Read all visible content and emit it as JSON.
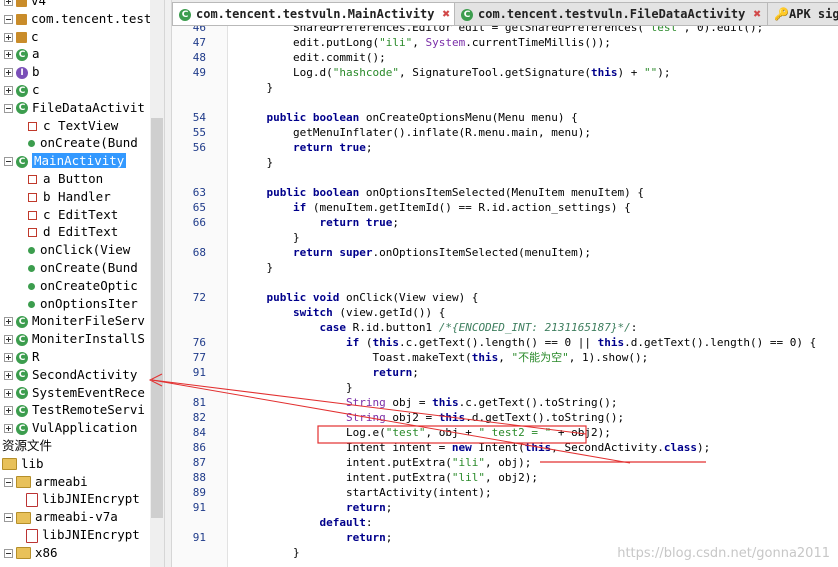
{
  "tree": {
    "items": [
      {
        "label": "v4",
        "icon": "pkg",
        "exp": "plus",
        "indent": 0
      },
      {
        "label": "com.tencent.testv",
        "icon": "pkg",
        "exp": "minus",
        "indent": 0
      },
      {
        "label": "c",
        "icon": "pkg",
        "exp": "plus",
        "indent": 0
      },
      {
        "label": "a",
        "icon": "c",
        "exp": "plus",
        "indent": 0
      },
      {
        "label": "b",
        "icon": "i",
        "exp": "plus",
        "indent": 0
      },
      {
        "label": "c",
        "icon": "c",
        "exp": "plus",
        "indent": 0
      },
      {
        "label": "FileDataActivit",
        "icon": "c",
        "exp": "minus",
        "indent": 0
      },
      {
        "label": "c TextView",
        "icon": "field",
        "exp": "",
        "indent": 1
      },
      {
        "label": "onCreate(Bund",
        "icon": "meth",
        "exp": "",
        "indent": 1
      },
      {
        "label": "MainActivity",
        "icon": "c",
        "exp": "minus",
        "indent": 0,
        "selected": true
      },
      {
        "label": "a Button",
        "icon": "field",
        "exp": "",
        "indent": 1
      },
      {
        "label": "b Handler",
        "icon": "field",
        "exp": "",
        "indent": 1
      },
      {
        "label": "c EditText",
        "icon": "field",
        "exp": "",
        "indent": 1
      },
      {
        "label": "d EditText",
        "icon": "field",
        "exp": "",
        "indent": 1
      },
      {
        "label": "onClick(View",
        "icon": "meth",
        "exp": "",
        "indent": 1
      },
      {
        "label": "onCreate(Bund",
        "icon": "meth",
        "exp": "",
        "indent": 1
      },
      {
        "label": "onCreateOptic",
        "icon": "meth",
        "exp": "",
        "indent": 1
      },
      {
        "label": "onOptionsIter",
        "icon": "meth",
        "exp": "",
        "indent": 1
      },
      {
        "label": "MoniterFileServ",
        "icon": "c",
        "exp": "plus",
        "indent": 0
      },
      {
        "label": "MoniterInstallS",
        "icon": "c",
        "exp": "plus",
        "indent": 0
      },
      {
        "label": "R",
        "icon": "c",
        "exp": "plus",
        "indent": 0
      },
      {
        "label": "SecondActivity",
        "icon": "c",
        "exp": "plus",
        "indent": 0
      },
      {
        "label": "SystemEventRece",
        "icon": "c",
        "exp": "plus",
        "indent": 0
      },
      {
        "label": "TestRemoteServi",
        "icon": "c",
        "exp": "plus",
        "indent": 0
      },
      {
        "label": "VulApplication",
        "icon": "c",
        "exp": "plus",
        "indent": 0
      },
      {
        "label": "资源文件",
        "icon": "none",
        "exp": "",
        "indent": -1
      },
      {
        "label": "lib",
        "icon": "folder",
        "exp": "",
        "indent": -1
      },
      {
        "label": "armeabi",
        "icon": "folder",
        "exp": "minus",
        "indent": 0
      },
      {
        "label": "libJNIEncrypt",
        "icon": "so",
        "exp": "",
        "indent": 1
      },
      {
        "label": "armeabi-v7a",
        "icon": "folder",
        "exp": "minus",
        "indent": 0
      },
      {
        "label": "libJNIEncrypt",
        "icon": "so",
        "exp": "",
        "indent": 1
      },
      {
        "label": "x86",
        "icon": "folder",
        "exp": "minus",
        "indent": 0
      }
    ]
  },
  "tabs": [
    {
      "label": "com.tencent.testvuln.MainActivity",
      "active": true,
      "icon": "c"
    },
    {
      "label": "com.tencent.testvuln.FileDataActivity",
      "active": false,
      "icon": "c"
    },
    {
      "label": "APK sig",
      "active": false,
      "icon": "key"
    }
  ],
  "code": [
    {
      "ln": "46",
      "html": "        SharedPreferences.Editor edit = getSharedPreferences(<span class=\"s\">\"test\"</span>, 0).edit();"
    },
    {
      "ln": "47",
      "html": "        edit.putLong(<span class=\"s\">\"ili\"</span>, <span class=\"t\">System</span>.currentTimeMillis());"
    },
    {
      "ln": "48",
      "html": "        edit.commit();"
    },
    {
      "ln": "49",
      "html": "        Log.d(<span class=\"s\">\"hashcode\"</span>, SignatureTool.getSignature(<span class=\"k\">this</span>) + <span class=\"s\">\"\"</span>);"
    },
    {
      "ln": "",
      "html": "    }"
    },
    {
      "ln": "",
      "html": ""
    },
    {
      "ln": "54",
      "html": "    <span class=\"k\">public boolean</span> onCreateOptionsMenu(Menu menu) {"
    },
    {
      "ln": "55",
      "html": "        getMenuInflater().inflate(R.menu.main, menu);"
    },
    {
      "ln": "56",
      "html": "        <span class=\"k\">return true</span>;"
    },
    {
      "ln": "",
      "html": "    }"
    },
    {
      "ln": "",
      "html": ""
    },
    {
      "ln": "63",
      "html": "    <span class=\"k\">public boolean</span> onOptionsItemSelected(MenuItem menuItem) {"
    },
    {
      "ln": "65",
      "html": "        <span class=\"k\">if</span> (menuItem.getItemId() == R.id.action_settings) {"
    },
    {
      "ln": "66",
      "html": "            <span class=\"k\">return true</span>;"
    },
    {
      "ln": "",
      "html": "        }"
    },
    {
      "ln": "68",
      "html": "        <span class=\"k\">return super</span>.onOptionsItemSelected(menuItem);"
    },
    {
      "ln": "",
      "html": "    }"
    },
    {
      "ln": "",
      "html": ""
    },
    {
      "ln": "72",
      "html": "    <span class=\"k\">public void</span> onClick(View view) {"
    },
    {
      "ln": "",
      "html": "        <span class=\"k\">switch</span> (view.getId()) {"
    },
    {
      "ln": "",
      "html": "            <span class=\"k\">case</span> R.id.button1 <span class=\"cm\">/*{ENCODED_INT: 2131165187}*/</span>:"
    },
    {
      "ln": "76",
      "html": "                <span class=\"k\">if</span> (<span class=\"k\">this</span>.c.getText().length() == 0 || <span class=\"k\">this</span>.d.getText().length() == 0) {"
    },
    {
      "ln": "77",
      "html": "                    Toast.makeText(<span class=\"k\">this</span>, <span class=\"s\">\"不能为空\"</span>, 1).show();"
    },
    {
      "ln": "91",
      "html": "                    <span class=\"k\">return</span>;"
    },
    {
      "ln": "",
      "html": "                }"
    },
    {
      "ln": "81",
      "html": "                <span class=\"t\">String</span> obj = <span class=\"k\">this</span>.c.getText().toString();"
    },
    {
      "ln": "82",
      "html": "                <span class=\"t\">String</span> obj2 = <span class=\"k\">this</span>.d.getText().toString();"
    },
    {
      "ln": "84",
      "html": "                Log.e(<span class=\"s\">\"test\"</span>, obj + <span class=\"s\">\" test2 = \"</span> + obj2);"
    },
    {
      "ln": "86",
      "html": "                Intent intent = <span class=\"k\">new</span> Intent(<span class=\"k\">this</span>, SecondActivity.<span class=\"k\">class</span>);"
    },
    {
      "ln": "87",
      "html": "                intent.putExtra(<span class=\"s\">\"ili\"</span>, obj);"
    },
    {
      "ln": "88",
      "html": "                intent.putExtra(<span class=\"s\">\"lil\"</span>, obj2);"
    },
    {
      "ln": "89",
      "html": "                startActivity(intent);"
    },
    {
      "ln": "91",
      "html": "                <span class=\"k\">return</span>;"
    },
    {
      "ln": "",
      "html": "            <span class=\"k\">default</span>:"
    },
    {
      "ln": "91",
      "html": "                <span class=\"k\">return</span>;"
    },
    {
      "ln": "",
      "html": "        }"
    }
  ],
  "watermark": "https://blog.csdn.net/gonna2011",
  "colors": {
    "annotation": "#e23030",
    "selection": "#3399ff"
  }
}
